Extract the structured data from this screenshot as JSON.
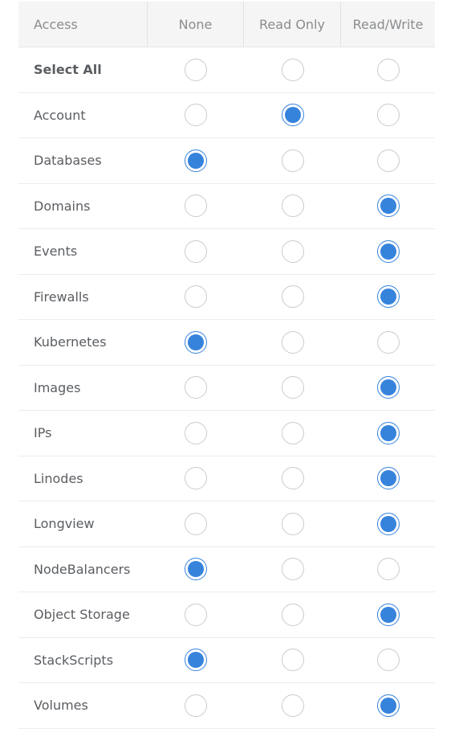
{
  "header": {
    "access": "Access",
    "none": "None",
    "read_only": "Read Only",
    "read_write": "Read/Write"
  },
  "colors": {
    "accent": "#3683dc",
    "radio_border": "#c9cbcd",
    "header_bg": "#f5f5f5",
    "text": "#5a5d61"
  },
  "rows": [
    {
      "label": "Select All",
      "bold": true,
      "selected": ""
    },
    {
      "label": "Account",
      "selected": "read_only"
    },
    {
      "label": "Databases",
      "selected": "none"
    },
    {
      "label": "Domains",
      "selected": "read_write"
    },
    {
      "label": "Events",
      "selected": "read_write"
    },
    {
      "label": "Firewalls",
      "selected": "read_write"
    },
    {
      "label": "Kubernetes",
      "selected": "none"
    },
    {
      "label": "Images",
      "selected": "read_write"
    },
    {
      "label": "IPs",
      "selected": "read_write"
    },
    {
      "label": "Linodes",
      "selected": "read_write"
    },
    {
      "label": "Longview",
      "selected": "read_write"
    },
    {
      "label": "NodeBalancers",
      "selected": "none"
    },
    {
      "label": "Object Storage",
      "selected": "read_write"
    },
    {
      "label": "StackScripts",
      "selected": "none"
    },
    {
      "label": "Volumes",
      "selected": "read_write"
    }
  ]
}
